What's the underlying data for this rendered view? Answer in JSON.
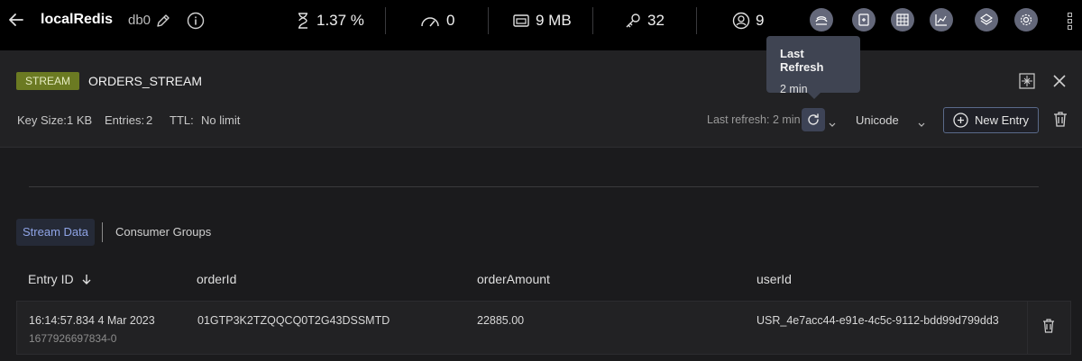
{
  "header": {
    "db_name": "localRedis",
    "db_index": "db0",
    "stats": {
      "cpu": "1.37 %",
      "ops": "0",
      "memory": "9 MB",
      "keys": "32",
      "clients": "9"
    },
    "icons": [
      "back-arrow-icon",
      "pencil-icon",
      "info-icon",
      "hourglass-icon",
      "speedometer-icon",
      "memory-chip-icon",
      "key-icon",
      "user-circle-icon",
      "workbench-icon",
      "bulk-actions-icon",
      "browser-icon",
      "analytics-icon",
      "layers-icon",
      "gear-icon",
      "kebab-icon"
    ]
  },
  "key_panel": {
    "type": "STREAM",
    "name": "ORDERS_STREAM",
    "key_size_label": "Key Size:",
    "key_size": "1 KB",
    "entries_label": "Entries:",
    "entries": "2",
    "ttl_label": "TTL:",
    "ttl": "No limit",
    "last_refresh": "Last refresh: 2 min",
    "format": "Unicode",
    "new_entry_label": "New Entry"
  },
  "tooltip": {
    "title": "Last Refresh",
    "value": "2 min"
  },
  "tabs": {
    "active": "Stream Data",
    "other": "Consumer Groups"
  },
  "table": {
    "columns": [
      "Entry ID",
      "orderId",
      "orderAmount",
      "userId"
    ],
    "rows": [
      {
        "timestamp": "16:14:57.834 4 Mar 2023",
        "entry_id": "1677926697834-0",
        "orderId": "01GTP3K2TZQQCQ0T2G43DSSMTD",
        "orderAmount": "22885.00",
        "userId": "USR_4e7acc44-e91e-4c5c-9112-bdd99d799dd3"
      }
    ]
  },
  "colors": {
    "accent": "#8fa4e6",
    "badge": "#6b7a22",
    "tool_button": "#64687a"
  }
}
